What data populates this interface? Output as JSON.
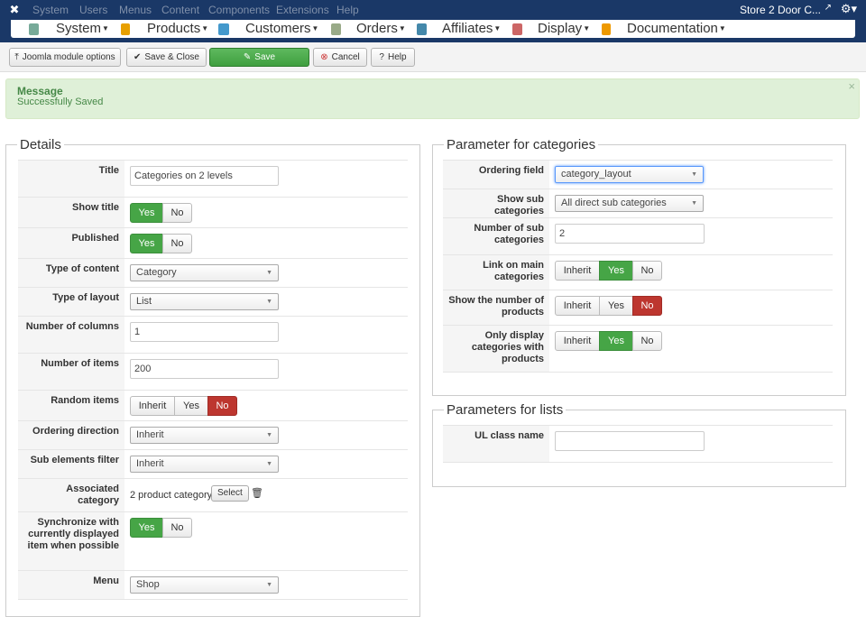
{
  "topmenu": {
    "items": [
      "System",
      "Users",
      "Menus",
      "Content",
      "Components",
      "Extensions",
      "Help"
    ],
    "site": "Store 2 Door C..."
  },
  "vmmenu": [
    {
      "label": "System",
      "icon": "tools-icon",
      "color": "#7a9"
    },
    {
      "label": "Products",
      "icon": "box-icon",
      "color": "#e8a000"
    },
    {
      "label": "Customers",
      "icon": "users-icon",
      "color": "#49c"
    },
    {
      "label": "Orders",
      "icon": "orders-icon",
      "color": "#9a8"
    },
    {
      "label": "Affiliates",
      "icon": "affiliates-icon",
      "color": "#48a"
    },
    {
      "label": "Display",
      "icon": "display-icon",
      "color": "#c66"
    },
    {
      "label": "Documentation",
      "icon": "docs-icon",
      "color": "#e90"
    }
  ],
  "toolbar": {
    "options": "Joomla module options",
    "save_close": "Save & Close",
    "save": "Save",
    "cancel": "Cancel",
    "help": "Help"
  },
  "message": {
    "heading": "Message",
    "text": "Successfully Saved",
    "close": "×"
  },
  "details": {
    "legend": "Details",
    "title_label": "Title",
    "title_value": "Categories on 2 levels",
    "show_title_label": "Show title",
    "published_label": "Published",
    "type_content_label": "Type of content",
    "type_content_value": "Category",
    "type_layout_label": "Type of layout",
    "type_layout_value": "List",
    "num_columns_label": "Number of columns",
    "num_columns_value": "1",
    "num_items_label": "Number of items",
    "num_items_value": "200",
    "random_label": "Random items",
    "ordering_dir_label": "Ordering direction",
    "ordering_dir_value": "Inherit",
    "sub_filter_label": "Sub elements filter",
    "sub_filter_value": "Inherit",
    "assoc_label": "Associated category",
    "assoc_value": "2 product category",
    "select": "Select",
    "sync_label": "Synchronize with currently displayed item when possible",
    "menu_label": "Menu",
    "menu_value": "Shop",
    "yes": "Yes",
    "no": "No",
    "inherit": "Inherit"
  },
  "categories": {
    "legend": "Parameter for categories",
    "ordering_label": "Ordering field",
    "ordering_value": "category_layout",
    "show_sub_label": "Show sub categories",
    "show_sub_value": "All direct sub categories",
    "num_sub_label": "Number of sub categories",
    "num_sub_value": "2",
    "link_main_label": "Link on main categories",
    "show_num_label": "Show the number of products",
    "only_display_label": "Only display categories with products"
  },
  "lists": {
    "legend": "Parameters for lists",
    "ul_label": "UL class name",
    "ul_value": ""
  }
}
